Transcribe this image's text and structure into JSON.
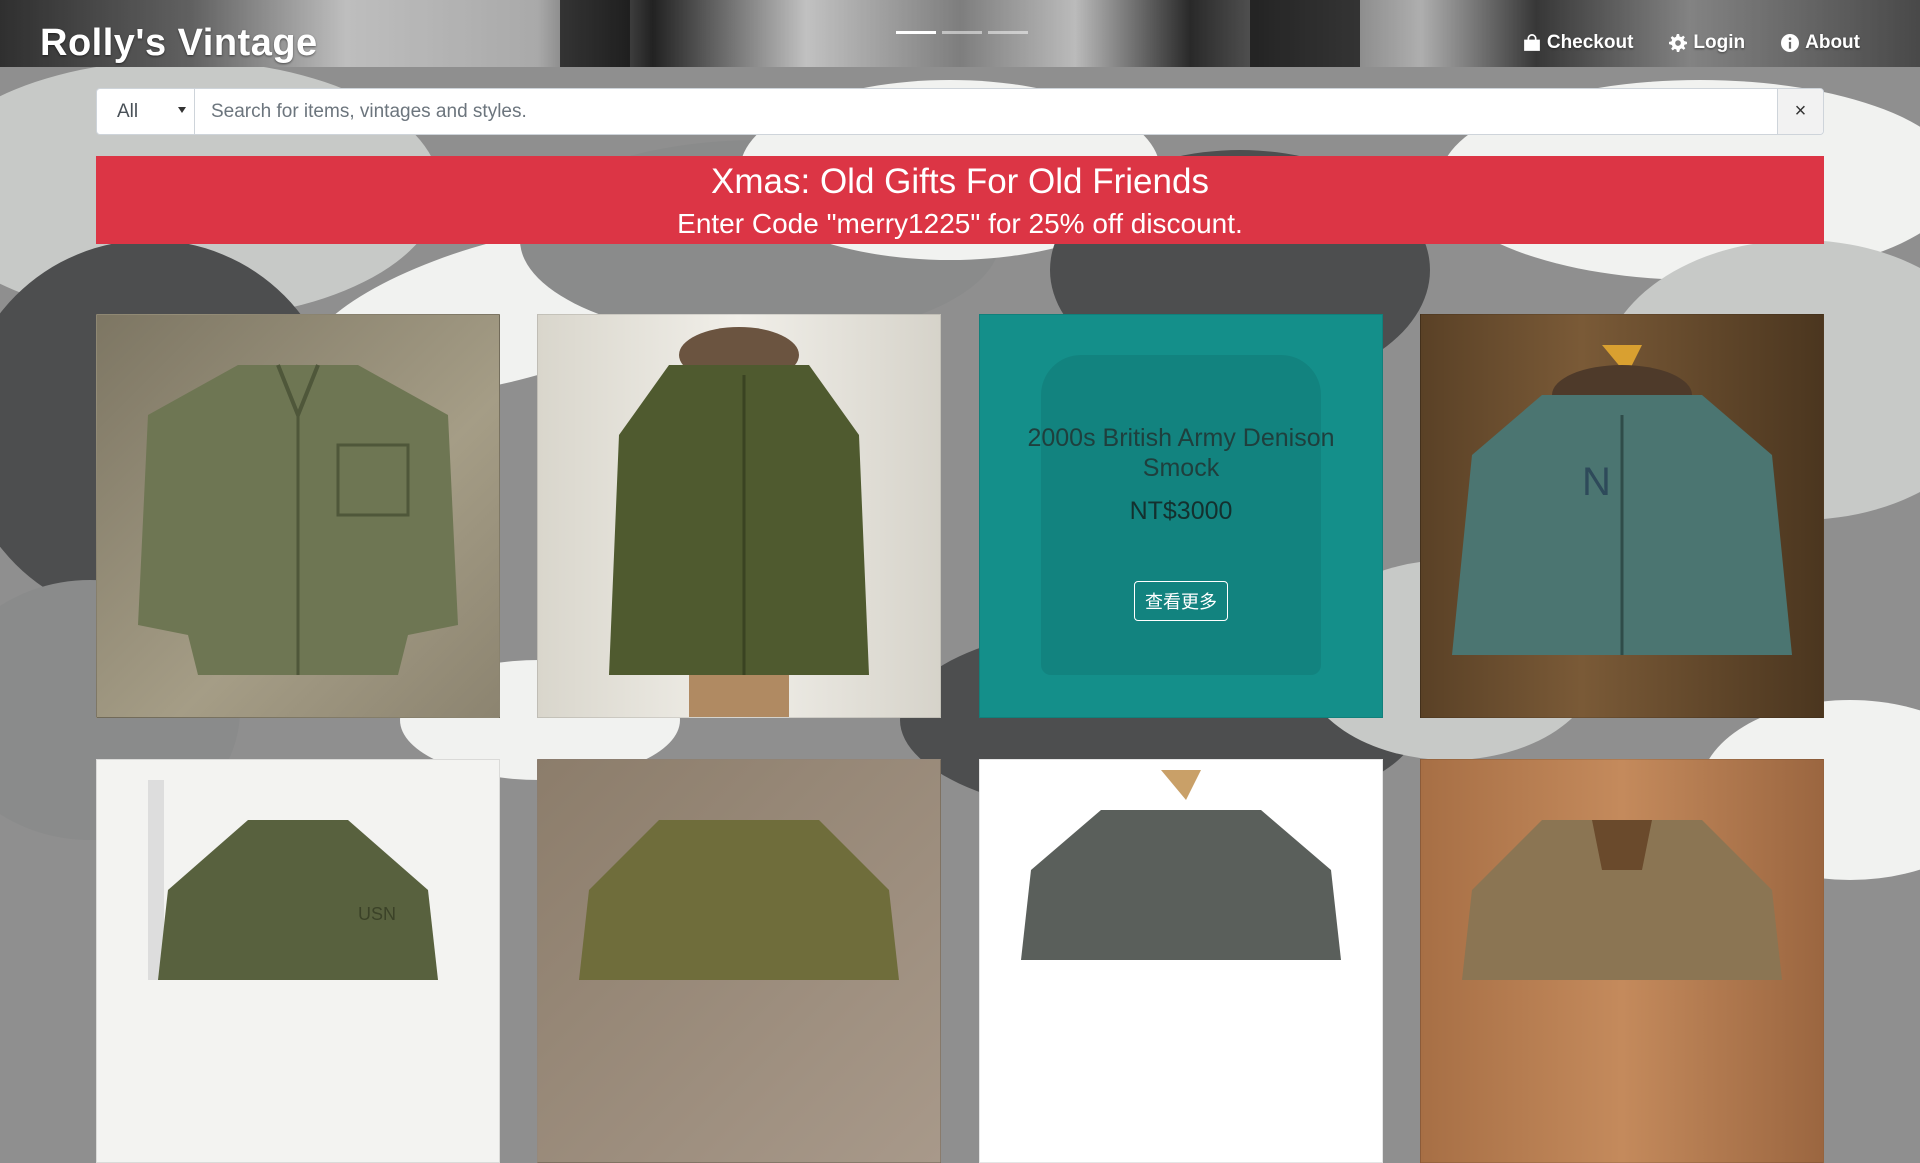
{
  "header": {
    "brand": "Rolly's Vintage",
    "nav": [
      {
        "label": "Checkout",
        "icon": "shopping-bag-icon"
      },
      {
        "label": "Login",
        "icon": "gear-icon"
      },
      {
        "label": "About",
        "icon": "info-icon"
      }
    ],
    "carousel_slides": 3,
    "carousel_active": 1
  },
  "search": {
    "category": "All",
    "placeholder": "Search for items, vintages and styles.",
    "clear_label": "×"
  },
  "promo": {
    "headline": "Xmas: Old Gifts For Old Friends",
    "subline": "Enter Code \"merry1225\" for 25% off discount.",
    "color": "#dc3545"
  },
  "products": [
    {
      "image": "usmc-herringbone-shirt"
    },
    {
      "image": "olive-deck-jacket-mannequin"
    },
    {
      "image": "denison-smock",
      "title": "2000s British Army Denison Smock",
      "price": "NT$3000",
      "more_label": "查看更多",
      "overlay_color": "#148f8a"
    },
    {
      "image": "usn-teal-deck-jacket"
    },
    {
      "image": "usn-hooded-parka"
    },
    {
      "image": "m65-field-jacket"
    },
    {
      "image": "grey-military-shirt"
    },
    {
      "image": "khaki-field-jacket"
    }
  ]
}
